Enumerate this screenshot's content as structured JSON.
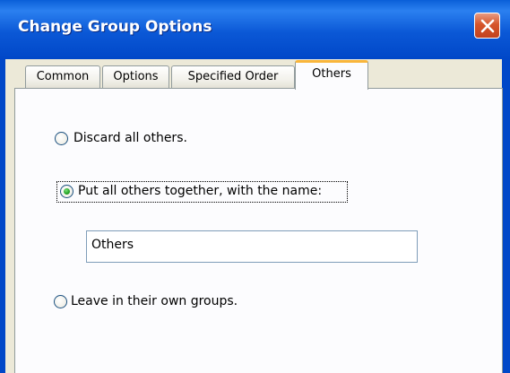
{
  "window": {
    "title": "Change Group Options"
  },
  "tabs": [
    {
      "label": "Common",
      "active": false
    },
    {
      "label": "Options",
      "active": false
    },
    {
      "label": "Specified Order",
      "active": false
    },
    {
      "label": "Others",
      "active": true
    }
  ],
  "others_panel": {
    "options": [
      {
        "label": "Discard all others.",
        "selected": false
      },
      {
        "label": "Put all others together, with the name:",
        "selected": true
      },
      {
        "label": "Leave in their own groups.",
        "selected": false
      }
    ],
    "others_name_value": "Others"
  },
  "colors": {
    "titlebar": "#0B58D6",
    "tab_active_accent": "#F9B63B",
    "radio_selected": "#21A121",
    "close_button": "#D6552A"
  }
}
